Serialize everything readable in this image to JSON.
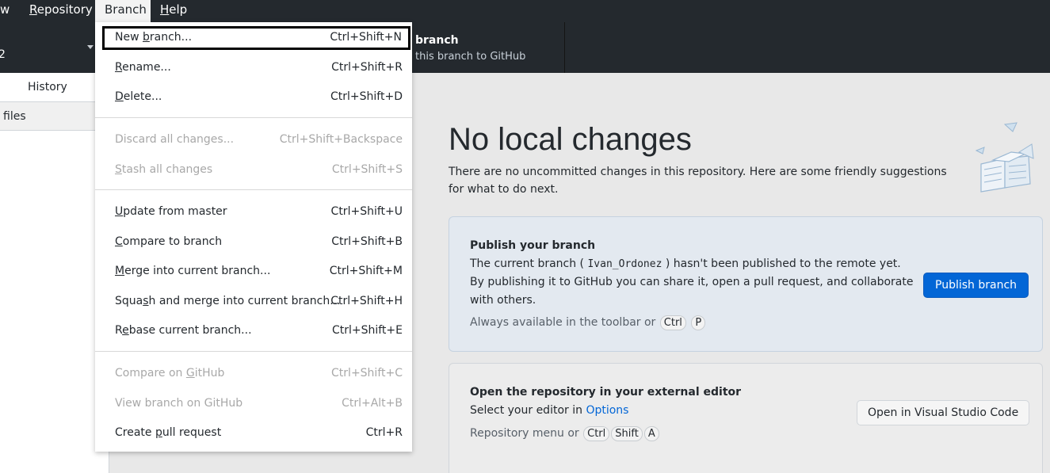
{
  "menubar": {
    "items": [
      {
        "pre": "",
        "ul": "",
        "post": "w"
      },
      {
        "pre": "",
        "ul": "R",
        "post": "epository"
      },
      {
        "pre": "",
        "ul": "",
        "post": "Branch"
      },
      {
        "pre": "",
        "ul": "H",
        "post": "elp"
      }
    ]
  },
  "toolbar": {
    "repo_value": "2",
    "publish_title": "branch",
    "publish_subtitle": "this branch to GitHub"
  },
  "sidebar": {
    "tab_history": "History",
    "changed_files": "files"
  },
  "main": {
    "heading": "No local changes",
    "intro": "There are no uncommitted changes in this repository. Here are some friendly suggestions for what to do next.",
    "publish_card": {
      "title": "Publish your branch",
      "body_1": "The current branch (",
      "branch_name": "Ivan_Ordonez",
      "body_2": ") hasn't been published to the remote yet. By publishing it to GitHub you can share it, open a pull request, and collaborate with others.",
      "hint": "Always available in the toolbar or",
      "key_1": "Ctrl",
      "key_2": "P",
      "button": "Publish branch"
    },
    "editor_card": {
      "title": "Open the repository in your external editor",
      "body": "Select your editor in",
      "link": "Options",
      "hint": "Repository menu or",
      "key_1": "Ctrl",
      "key_2": "Shift",
      "key_3": "A",
      "button": "Open in Visual Studio Code"
    }
  },
  "dropdown": {
    "items": [
      {
        "pre": "New ",
        "ul": "b",
        "post": "ranch...",
        "accel": "Ctrl+Shift+N",
        "disabled": false
      },
      {
        "pre": "",
        "ul": "R",
        "post": "ename...",
        "accel": "Ctrl+Shift+R",
        "disabled": false
      },
      {
        "pre": "",
        "ul": "D",
        "post": "elete...",
        "accel": "Ctrl+Shift+D",
        "disabled": false
      },
      {
        "pre": "Discard all changes...",
        "ul": "",
        "post": "",
        "accel": "Ctrl+Shift+Backspace",
        "disabled": true
      },
      {
        "pre": "",
        "ul": "S",
        "post": "tash all changes",
        "accel": "Ctrl+Shift+S",
        "disabled": true
      },
      {
        "pre": "",
        "ul": "U",
        "post": "pdate from master",
        "accel": "Ctrl+Shift+U",
        "disabled": false
      },
      {
        "pre": "",
        "ul": "C",
        "post": "ompare to branch",
        "accel": "Ctrl+Shift+B",
        "disabled": false
      },
      {
        "pre": "",
        "ul": "M",
        "post": "erge into current branch...",
        "accel": "Ctrl+Shift+M",
        "disabled": false
      },
      {
        "pre": "Squa",
        "ul": "s",
        "post": "h and merge into current branch...",
        "accel": "Ctrl+Shift+H",
        "disabled": false
      },
      {
        "pre": "R",
        "ul": "e",
        "post": "base current branch...",
        "accel": "Ctrl+Shift+E",
        "disabled": false
      },
      {
        "pre": "Compare on ",
        "ul": "G",
        "post": "itHub",
        "accel": "Ctrl+Shift+C",
        "disabled": true
      },
      {
        "pre": "View branch on GitHub",
        "ul": "",
        "post": "",
        "accel": "Ctrl+Alt+B",
        "disabled": true
      },
      {
        "pre": "Create ",
        "ul": "p",
        "post": "ull request",
        "accel": "Ctrl+R",
        "disabled": false
      }
    ]
  }
}
